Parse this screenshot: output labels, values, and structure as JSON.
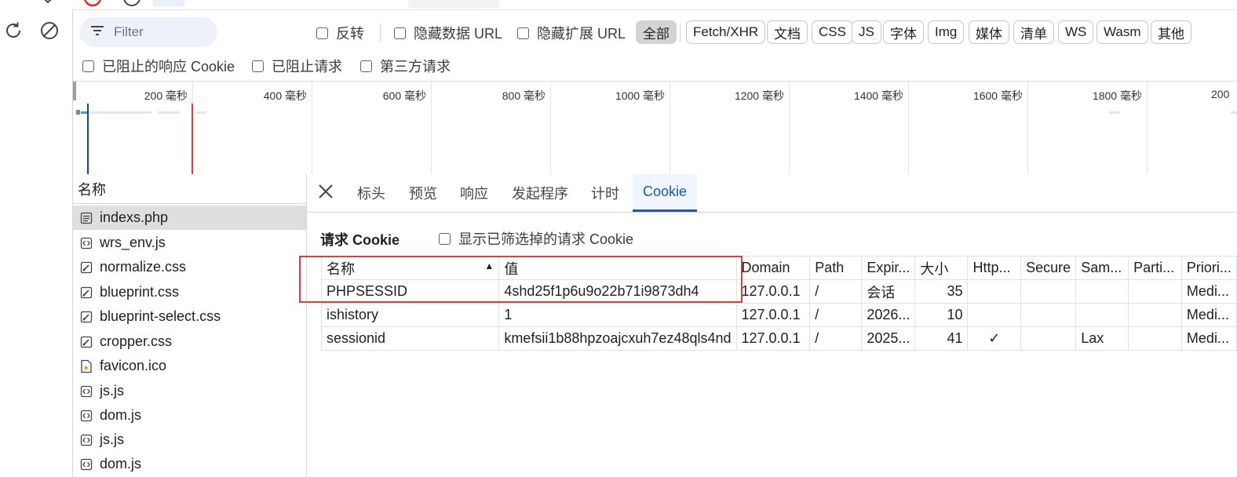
{
  "toolbar": {
    "filter_placeholder": "Filter",
    "invert_label": "反转",
    "hide_data_url_label": "隐藏数据 URL",
    "hide_ext_url_label": "隐藏扩展 URL",
    "blocked_response_cookie_label": "已阻止的响应 Cookie",
    "blocked_requests_label": "已阻止请求",
    "third_party_label": "第三方请求",
    "type_filters": [
      "全部",
      "Fetch/XHR",
      "文档",
      "CSS",
      "JS",
      "字体",
      "Img",
      "媒体",
      "清单",
      "WS",
      "Wasm",
      "其他"
    ],
    "active_filter": "全部"
  },
  "overview": {
    "ticks": [
      "200 毫秒",
      "400 毫秒",
      "600 毫秒",
      "800 毫秒",
      "1000 毫秒",
      "1200 毫秒",
      "1400 毫秒",
      "1600 毫秒",
      "1800 毫秒",
      "200"
    ]
  },
  "request_list": {
    "header": "名称",
    "items": [
      {
        "name": "indexs.php",
        "icon": "document-icon"
      },
      {
        "name": "wrs_env.js",
        "icon": "script-icon"
      },
      {
        "name": "normalize.css",
        "icon": "stylesheet-icon"
      },
      {
        "name": "blueprint.css",
        "icon": "stylesheet-icon"
      },
      {
        "name": "blueprint-select.css",
        "icon": "stylesheet-icon"
      },
      {
        "name": "cropper.css",
        "icon": "stylesheet-icon"
      },
      {
        "name": "favicon.ico",
        "icon": "image-icon"
      },
      {
        "name": "js.js",
        "icon": "script-icon"
      },
      {
        "name": "dom.js",
        "icon": "script-icon"
      },
      {
        "name": "js.js",
        "icon": "script-icon"
      },
      {
        "name": "dom.js",
        "icon": "script-icon"
      }
    ]
  },
  "detail": {
    "tabs": [
      "标头",
      "预览",
      "响应",
      "发起程序",
      "计时",
      "Cookie"
    ],
    "active_tab": "Cookie",
    "section_title": "请求 Cookie",
    "show_filtered_label": "显示已筛选掉的请求 Cookie",
    "columns": [
      "名称",
      "值",
      "Domain",
      "Path",
      "Expir...",
      "大小",
      "Http...",
      "Secure",
      "Sam...",
      "Parti...",
      "Priori..."
    ],
    "rows": [
      [
        "PHPSESSID",
        "4shd25f1p6u9o22b71i9873dh4",
        "127.0.0.1",
        "/",
        "会话",
        "35",
        "",
        "",
        "",
        "",
        "Medi..."
      ],
      [
        "ishistory",
        "1",
        "127.0.0.1",
        "/",
        "2026...",
        "10",
        "",
        "",
        "",
        "",
        "Medi..."
      ],
      [
        "sessionid",
        "kmefsii1b88hpzoajcxuh7ez48qls4nd",
        "127.0.0.1",
        "/",
        "2025...",
        "41",
        "✓",
        "",
        "Lax",
        "",
        "Medi..."
      ]
    ]
  },
  "colors": {
    "accent": "#1a56c8",
    "highlight": "#e23b3b",
    "dom_content_loaded_line": "#1f3fa8",
    "load_line": "#e23b3b"
  }
}
